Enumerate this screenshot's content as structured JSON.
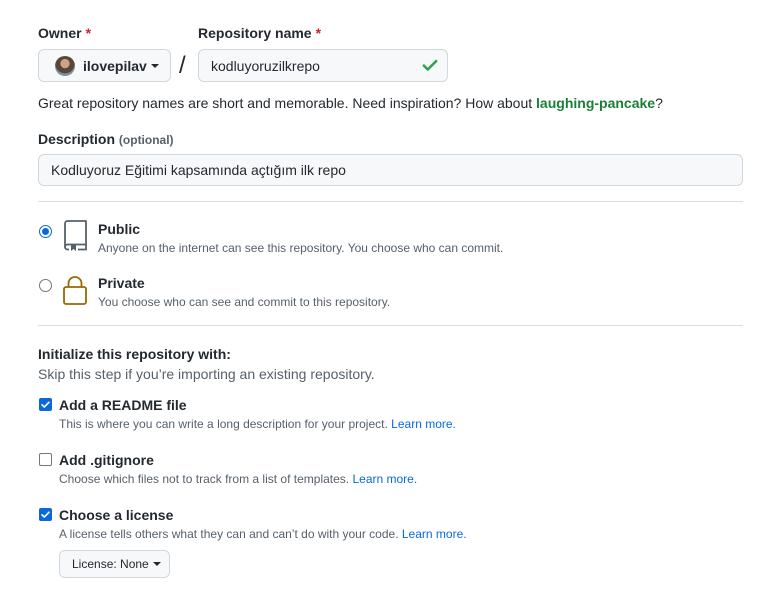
{
  "owner": {
    "label": "Owner",
    "required_mark": "*",
    "username": "ilovepilav"
  },
  "repo": {
    "label": "Repository name",
    "required_mark": "*",
    "separator": "/",
    "value": "kodluyoruzilkrepo",
    "status_icon": "check-icon"
  },
  "suggestion": {
    "text": "Great repository names are short and memorable. Need inspiration? How about ",
    "name": "laughing-pancake",
    "suffix": "?"
  },
  "description": {
    "label": "Description",
    "optional": "(optional)",
    "value": "Kodluyoruz Eğitimi kapsamında açtığım ilk repo"
  },
  "visibility": {
    "options": [
      {
        "title": "Public",
        "desc": "Anyone on the internet can see this repository. You choose who can commit.",
        "icon": "repo-icon",
        "selected": true
      },
      {
        "title": "Private",
        "desc": "You choose who can see and commit to this repository.",
        "icon": "lock-icon",
        "selected": false
      }
    ]
  },
  "init": {
    "title": "Initialize this repository with:",
    "subtitle": "Skip this step if you’re importing an existing repository.",
    "items": [
      {
        "title": "Add a README file",
        "desc": "This is where you can write a long description for your project.",
        "link": "Learn more.",
        "checked": true
      },
      {
        "title": "Add .gitignore",
        "desc": "Choose which files not to track from a list of templates.",
        "link": "Learn more.",
        "checked": false
      },
      {
        "title": "Choose a license",
        "desc": "A license tells others what they can and can’t do with your code.",
        "link": "Learn more.",
        "checked": true
      }
    ],
    "license_button": "License: None"
  },
  "colors": {
    "accent": "#0969da",
    "success": "#2da44e",
    "suggestion": "#1a7f37",
    "danger": "#cf222e",
    "lock": "#9a6700"
  }
}
